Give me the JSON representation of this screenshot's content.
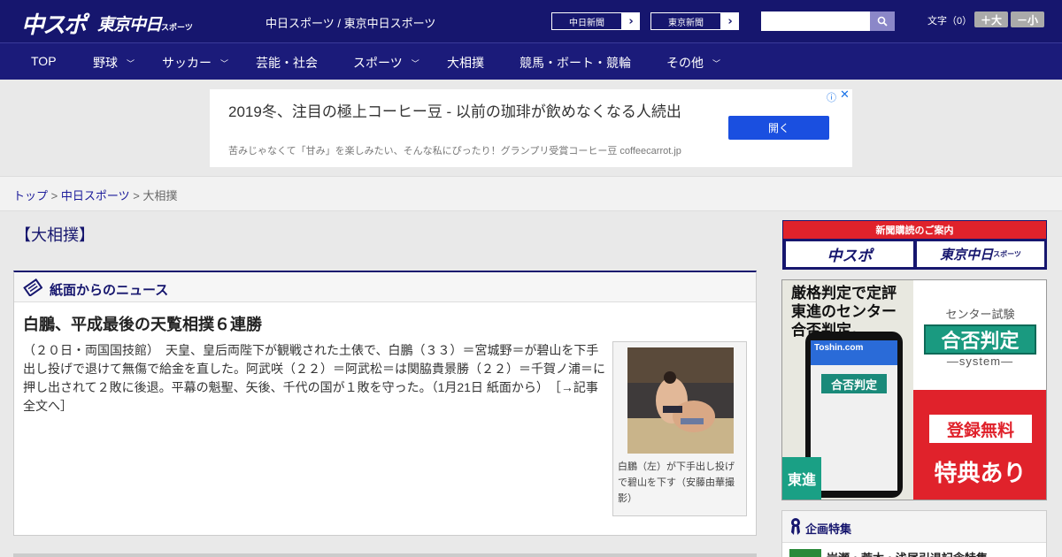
{
  "header": {
    "logo_chuspo": "中スポ",
    "logo_tokyo": "東京中日",
    "logo_tokyo_suffix": "スポーツ",
    "site_names": "中日スポーツ / 東京中日スポーツ",
    "btn_chunichi": "中日新聞",
    "btn_tokyo": "東京新聞",
    "search_placeholder": "",
    "font_label": "文字（0）",
    "font_larger": "＋大",
    "font_smaller": "－小"
  },
  "nav": {
    "items": [
      {
        "label": "TOP",
        "has_menu": false
      },
      {
        "label": "野球",
        "has_menu": true
      },
      {
        "label": "サッカー",
        "has_menu": true
      },
      {
        "label": "芸能・社会",
        "has_menu": false
      },
      {
        "label": "スポーツ",
        "has_menu": true
      },
      {
        "label": "大相撲",
        "has_menu": false
      },
      {
        "label": "競馬・ボート・競輪",
        "has_menu": false
      },
      {
        "label": "その他",
        "has_menu": true
      }
    ]
  },
  "ad": {
    "title": "2019冬、注目の極上コーヒー豆 - 以前の珈琲が飲めなくなる人続出",
    "description": "苦みじゃなくて「甘み」を楽しみたい、そんな私にぴったり！グランプリ受賞コーヒー豆 coffeecarrot.jp",
    "open_label": "開く",
    "info_glyph": "ⓘ",
    "close_glyph": "✕"
  },
  "breadcrumb": {
    "home": "トップ",
    "sep": " > ",
    "section": "中日スポーツ",
    "current": "大相撲"
  },
  "page": {
    "heading": "【大相撲】"
  },
  "news": {
    "section_title": "紙面からのニュース",
    "article_title": "白鵬、平成最後の天覧相撲６連勝",
    "article_body": "（２０日・両国国技館）　天皇、皇后両陛下が観戦された土俵で、白鵬（３３）＝宮城野＝が碧山を下手出し投げで退けて無傷で給金を直した。阿武咲（２２）＝阿武松＝は関脇貴景勝（２２）＝千賀ノ浦＝に押し出されて２敗に後退。平幕の魁聖、矢後、千代の国が１敗を守った。（1月21日 紙面から）　［→記事全文へ］",
    "photo_caption": "白鵬（左）が下手出し投げで碧山を下す（安藤由華撮影）"
  },
  "sidebar": {
    "subscribe_title": "新聞購読のご案内",
    "subscribe_logo_1": "中スポ",
    "subscribe_logo_2": "東京中日",
    "subscribe_logo_2_suffix": "スポーツ",
    "banner": {
      "headline": "厳格判定で定評 東進のセンター 合否判定。",
      "phone_header": "Toshin.com",
      "phone_gohi": "合否判定",
      "toshin_label": "東進",
      "center_label": "センター試験",
      "gohi_label": "合否判定",
      "system_label": "—system—",
      "free_label": "登録無料",
      "tokuten_label": "特典あり"
    },
    "plan_title": "企画特集",
    "plan_item": "岩瀬・荒木・浅尾引退記念特集"
  },
  "colors": {
    "brand_navy": "#16166e",
    "accent_red": "#e0222b",
    "ad_button_blue": "#1a4fe0"
  }
}
